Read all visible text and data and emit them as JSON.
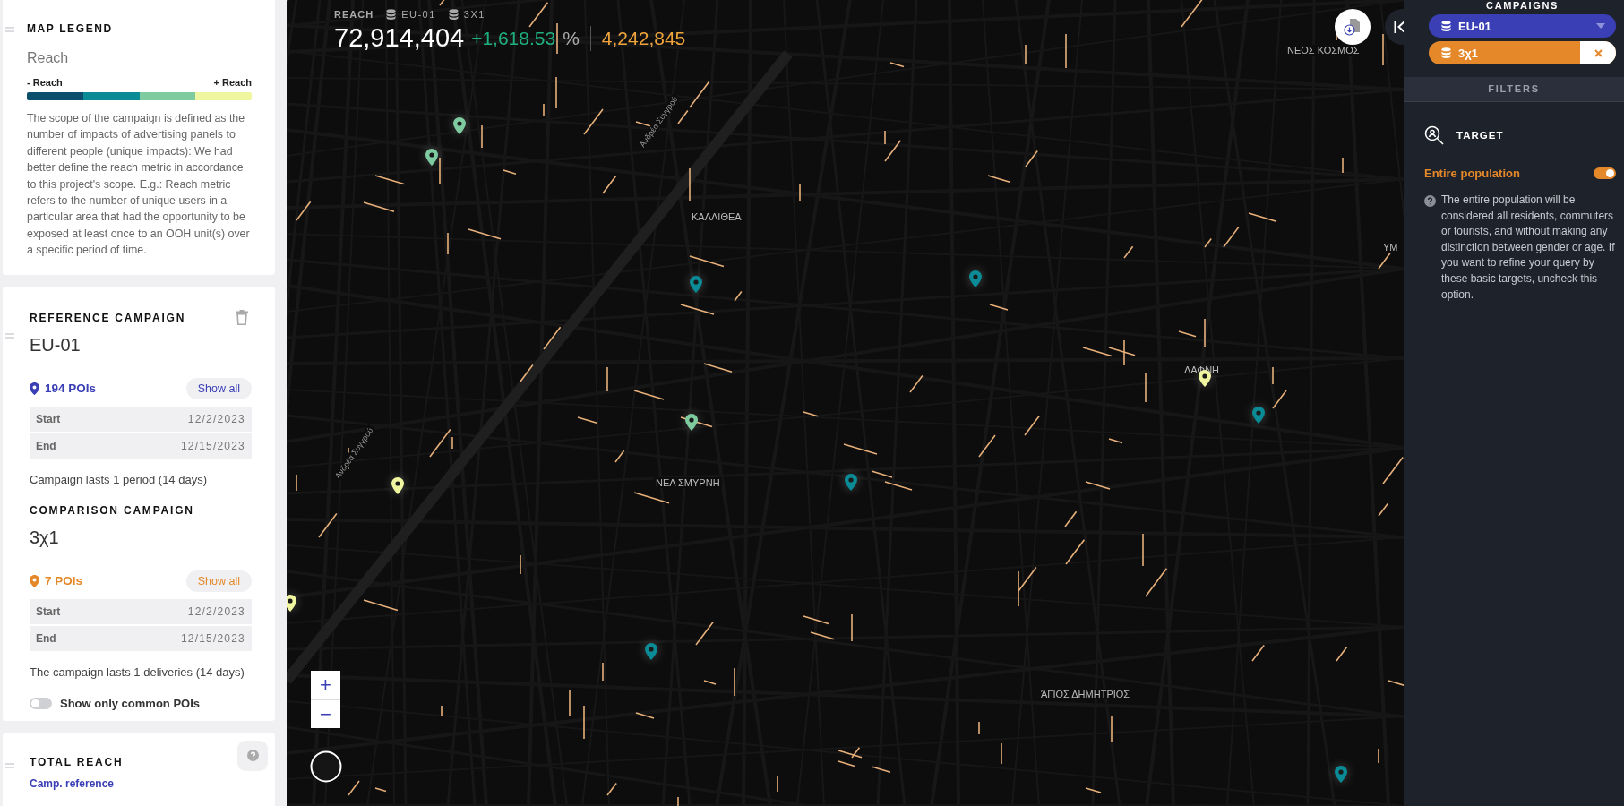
{
  "legend": {
    "title": "MAP LEGEND",
    "metric": "Reach",
    "low_label": "- Reach",
    "high_label": "+ Reach",
    "scale": [
      {
        "color": "#0b4f6c"
      },
      {
        "color": "#0a8b95"
      },
      {
        "color": "#7fcba0"
      },
      {
        "color": "#f0f5a0"
      }
    ],
    "description": "The scope of the campaign is defined as the number of impacts of advertising panels to different people (unique impacts): We had better define the reach metric in accordance to this project's scope. E.g.: Reach metric refers to the number of unique users in a particular area that had the opportunity to be exposed at least once to an OOH unit(s) over a specific period of time."
  },
  "campaigns": [
    {
      "kind": "reference",
      "heading": "REFERENCE CAMPAIGN",
      "name": "EU-01",
      "poi_count": "194 POIs",
      "show_all": "Show all",
      "dates": [
        {
          "label": "Start",
          "value": "12/2/2023"
        },
        {
          "label": "End",
          "value": "12/15/2023"
        }
      ],
      "duration": "Campaign lasts 1 period (14 days)"
    },
    {
      "kind": "comparison",
      "heading": "COMPARISON CAMPAIGN",
      "name": "3χ1",
      "poi_count": "7 POIs",
      "show_all": "Show all",
      "dates": [
        {
          "label": "Start",
          "value": "12/2/2023"
        },
        {
          "label": "End",
          "value": "12/15/2023"
        }
      ],
      "duration": "The campaign lasts 1 deliveries (14 days)"
    }
  ],
  "common_pois_toggle": {
    "label": "Show only common POIs",
    "on": false
  },
  "total_reach": {
    "title": "TOTAL REACH",
    "subtitle": "Camp. reference"
  },
  "map": {
    "header": {
      "title": "REACH",
      "layers": [
        "EU-01",
        "3X1"
      ],
      "value": "72,914,404",
      "change": "+1,618.53",
      "unit": "%",
      "comparison_value": "4,242,845"
    },
    "labels": [
      {
        "kind": "place",
        "text": "ΝΕΟΣ ΚΟΣΜΟΣ"
      },
      {
        "kind": "place",
        "text": "ΚΑΛΛΙΘΕΑ"
      },
      {
        "kind": "street",
        "text": "Ανδρέα Συγγρού"
      },
      {
        "kind": "place",
        "text": "ΥΜ"
      },
      {
        "kind": "place",
        "text": "ΔΑΦΝΗ"
      },
      {
        "kind": "place",
        "text": "ΝΕΑ ΣΜΥΡΝΗ"
      },
      {
        "kind": "street",
        "text": "Ανδρέα Συγγρού"
      },
      {
        "kind": "place",
        "text": "ΆΓΙΟΣ ΔΗΜΗΤΡΙΟΣ"
      }
    ],
    "markers": [
      {
        "color": "#7fcba0"
      },
      {
        "color": "#7fcba0"
      },
      {
        "color": "#0a8b95"
      },
      {
        "color": "#0a8b95"
      },
      {
        "color": "#7fcba0"
      },
      {
        "color": "#f0f5a0"
      },
      {
        "color": "#0a8b95"
      },
      {
        "color": "#f0f5a0"
      },
      {
        "color": "#0a8b95"
      },
      {
        "color": "#f0f5a0"
      },
      {
        "color": "#0a8b95"
      },
      {
        "color": "#0a8b95"
      }
    ],
    "zoom_in": "+",
    "zoom_out": "−"
  },
  "sidebar": {
    "title": "CAMPAIGNS",
    "campaigns": [
      {
        "kind": "selector",
        "name": "EU-01",
        "color": "#3a3fb5"
      },
      {
        "kind": "removable",
        "name": "3χ1",
        "color": "#e5882a"
      }
    ],
    "filters_tab": "FILTERS",
    "target": {
      "title": "TARGET",
      "option": "Entire population",
      "on": true,
      "help": "The entire population will be considered all residents, commuters or tourists, and without making any distinction between gender or age. If you want to refine your query by these basic targets, uncheck this option."
    }
  }
}
